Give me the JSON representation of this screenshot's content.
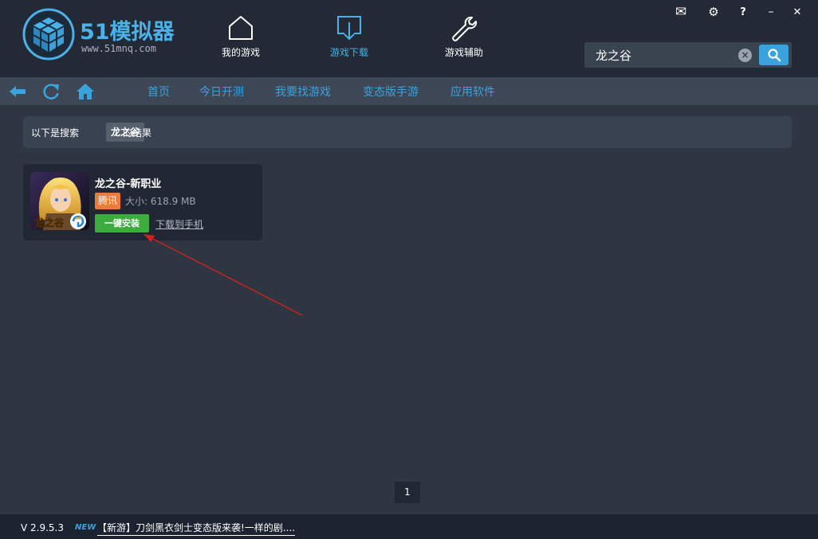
{
  "header": {
    "logo_text": "51模拟器",
    "logo_url": "www.51mnq.com",
    "nav": [
      {
        "label": "我的游戏",
        "icon": "home-icon"
      },
      {
        "label": "游戏下载",
        "icon": "download-icon"
      },
      {
        "label": "游戏辅助",
        "icon": "wrench-icon"
      }
    ],
    "active_nav": "游戏下载",
    "window_controls": [
      {
        "icon": "mail-icon",
        "glyph": "✉"
      },
      {
        "icon": "gear-icon",
        "glyph": "⚙"
      },
      {
        "icon": "help-icon",
        "glyph": "?"
      },
      {
        "icon": "minimize-icon",
        "glyph": "–"
      },
      {
        "icon": "close-icon",
        "glyph": "✕"
      }
    ],
    "search": {
      "value": "龙之谷",
      "placeholder": ""
    }
  },
  "subnav": {
    "tabs": [
      "首页",
      "今日开测",
      "我要找游戏",
      "变态版手游",
      "应用软件"
    ]
  },
  "result": {
    "prefix": "以下是搜索",
    "keyword": "龙之谷",
    "suffix": "的结果"
  },
  "games": [
    {
      "title": "龙之谷-新职业",
      "publisher": "腾讯",
      "size": "大小: 618.9 MB",
      "install_label": "一键安装",
      "download_label": "下载到手机",
      "thumb_text": "龙之谷"
    }
  ],
  "pagination": {
    "pages": [
      "1"
    ],
    "current": "1"
  },
  "footer": {
    "version": "V 2.9.5.3",
    "new_badge": "NEW",
    "news": "【新游】刀剑黑衣剑士变态版来袭!一样的剧...."
  },
  "colors": {
    "accent": "#3aa3de",
    "header_bg": "#232a35",
    "body_bg": "#2e3642",
    "install_green": "#3eab3e",
    "publisher_orange": "#f07a3c",
    "annotation_red": "#d42020"
  }
}
